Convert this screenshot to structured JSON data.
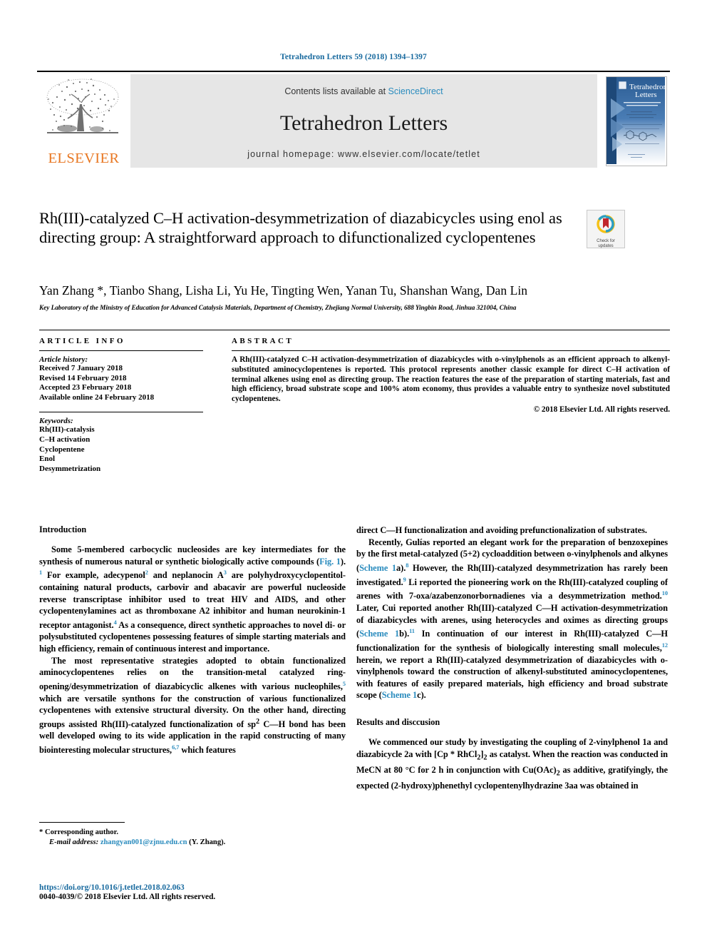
{
  "running_head": "Tetrahedron Letters 59 (2018) 1394–1397",
  "masthead": {
    "publisher_name": "ELSEVIER",
    "contents_prefix": "Contents lists available at ",
    "sciencedirect_link": "ScienceDirect",
    "journal_name": "Tetrahedron Letters",
    "homepage_line": "journal homepage: www.elsevier.com/locate/tetlet",
    "cover_title_line1": "Tetrahedron",
    "cover_title_line2": "Letters"
  },
  "article": {
    "title": "Rh(III)-catalyzed C–H activation-desymmetrization of diazabicycles using enol as directing group: A straightforward approach to difunctionalized cyclopentenes",
    "authors": "Yan Zhang *, Tianbo Shang, Lisha Li, Yu He, Tingting Wen, Yanan Tu, Shanshan Wang, Dan Lin",
    "affiliation": "Key Laboratory of the Ministry of Education for Advanced Catalysis Materials, Department of Chemistry, Zhejiang Normal University, 688 Yingbin Road, Jinhua 321004, China",
    "crossmark_label_line1": "Check for",
    "crossmark_label_line2": "updates"
  },
  "article_info": {
    "heading": "ARTICLE INFO",
    "history_label": "Article history:",
    "history": [
      "Received 7 January 2018",
      "Revised 14 February 2018",
      "Accepted 23 February 2018",
      "Available online 24 February 2018"
    ],
    "keywords_label": "Keywords:",
    "keywords": [
      "Rh(III)-catalysis",
      "C–H activation",
      "Cyclopentene",
      "Enol",
      "Desymmetrization"
    ]
  },
  "abstract": {
    "heading": "ABSTRACT",
    "text": "A Rh(III)-catalyzed C–H activation-desymmetrization of diazabicycles with o-vinylphenols as an efficient approach to alkenyl-substituted aminocyclopentenes is reported. This protocol represents another classic example for direct C–H activation of terminal alkenes using enol as directing group. The reaction features the ease of the preparation of starting materials, fast and high efficiency, broad substrate scope and 100% atom economy, thus provides a valuable entry to synthesize novel substituted cyclopentenes.",
    "copyright": "© 2018 Elsevier Ltd. All rights reserved."
  },
  "body": {
    "intro_heading": "Introduction",
    "intro_p1_a": "Some 5-membered carbocyclic nucleosides are key intermediates for the synthesis of numerous natural or synthetic biologically active compounds (",
    "intro_fig1": "Fig. 1",
    "intro_p1_b": "). ",
    "intro_ref1": "1",
    "intro_p1_c": " For example, adecypenol",
    "intro_ref2": "2",
    "intro_p1_d": " and neplanocin A",
    "intro_ref3": "3",
    "intro_p1_e": " are polyhydroxycyclopentitol-containing natural products, carbovir and abacavir are powerful nucleoside reverse transcriptase inhibitor used to treat HIV and AIDS, and other cyclopentenylamines act as thromboxane A2 inhibitor and human neurokinin-1 receptor antagonist.",
    "intro_ref4": "4",
    "intro_p1_f": " As a consequence, direct synthetic approaches to novel di- or polysubstituted cyclopentenes possessing features of simple starting materials and high efficiency, remain of continuous interest and importance.",
    "intro_p2_a": "The most representative strategies adopted to obtain functionalized aminocyclopentenes relies on the transition-metal catalyzed ring-opening/desymmetrization of diazabicyclic alkenes with various nucleophiles,",
    "intro_ref5": "5",
    "intro_p2_b": " which are versatile synthons for the construction of various functionalized cyclopentenes with extensive structural diversity. On the other hand, directing groups assisted Rh(III)-catalyzed functionalization of sp",
    "intro_sup2": "2",
    "intro_p2_c": " C—H bond has been well developed owing to its wide application in the rapid constructing of many biointeresting molecular structures,",
    "intro_ref67": "6,7",
    "intro_p2_d": " which features",
    "right_p1": "direct C—H functionalization and avoiding prefunctionalization of substrates.",
    "right_p2_a": "Recently, Gulías reported an elegant work for the preparation of benzoxepines by the first metal-catalyzed (5+2) cycloaddition between o-vinylphenols and alkynes (",
    "right_scheme1a": "Scheme 1",
    "right_p2_b": "a).",
    "right_ref8": "8",
    "right_p2_c": " However, the Rh(III)-catalyzed desymmetrization has rarely been investigated.",
    "right_ref9": "9",
    "right_p2_d": " Li reported the pioneering work on the Rh(III)-catalyzed coupling of arenes with 7-oxa/azabenzonorbornadienes via a desymmetrization method.",
    "right_ref10": "10",
    "right_p2_e": " Later, Cui reported another Rh(III)-catalyzed C—H activation-desymmetrization of diazabicycles with arenes, using heterocycles and oximes as directing groups (",
    "right_scheme1b": "Scheme 1",
    "right_p2_f": "b).",
    "right_ref11": "11",
    "right_p2_g": " In continuation of our interest in Rh(III)-catalyzed C—H functionalization for the synthesis of biologically interesting small molecules,",
    "right_ref12": "12",
    "right_p2_h": " herein, we report a Rh(III)-catalyzed desymmetrization of diazabicycles with o-vinylphenols toward the construction of alkenyl-substituted aminocyclopentenes, with features of easily prepared materials, high efficiency and broad substrate scope (",
    "right_scheme1c": "Scheme 1",
    "right_p2_i": "c).",
    "results_heading": "Results and disccusion",
    "results_p1_a": "We commenced our study by investigating the coupling of 2-vinylphenol ",
    "results_b1a": "1a",
    "results_p1_b": " and diazabicycle ",
    "results_b2a": "2a",
    "results_p1_c": " with [Cp * RhCl",
    "results_sub2": "2",
    "results_p1_d": "]",
    "results_sub2b": "2",
    "results_p1_e": " as catalyst. When the reaction was conducted in MeCN at 80 °C for 2 h in conjunction with Cu(OAc)",
    "results_sub2c": "2",
    "results_p1_f": " as additive, gratifyingly, the expected (2-hydroxy)phenethyl cyclopentenylhydrazine ",
    "results_b3aa": "3aa",
    "results_p1_g": " was obtained in"
  },
  "footnote": {
    "corresponding": "* Corresponding author.",
    "email_label": "E-mail address:",
    "email": "zhangyan001@zjnu.edu.cn",
    "email_suffix": "(Y. Zhang)."
  },
  "footer": {
    "doi": "https://doi.org/10.1016/j.tetlet.2018.02.063",
    "issn_line": "0040-4039/© 2018 Elsevier Ltd. All rights reserved."
  },
  "colors": {
    "link_blue": "#2b8cbe",
    "header_blue": "#17699e",
    "elsevier_orange": "#e87722",
    "banner_gray": "#e6e6e6"
  }
}
